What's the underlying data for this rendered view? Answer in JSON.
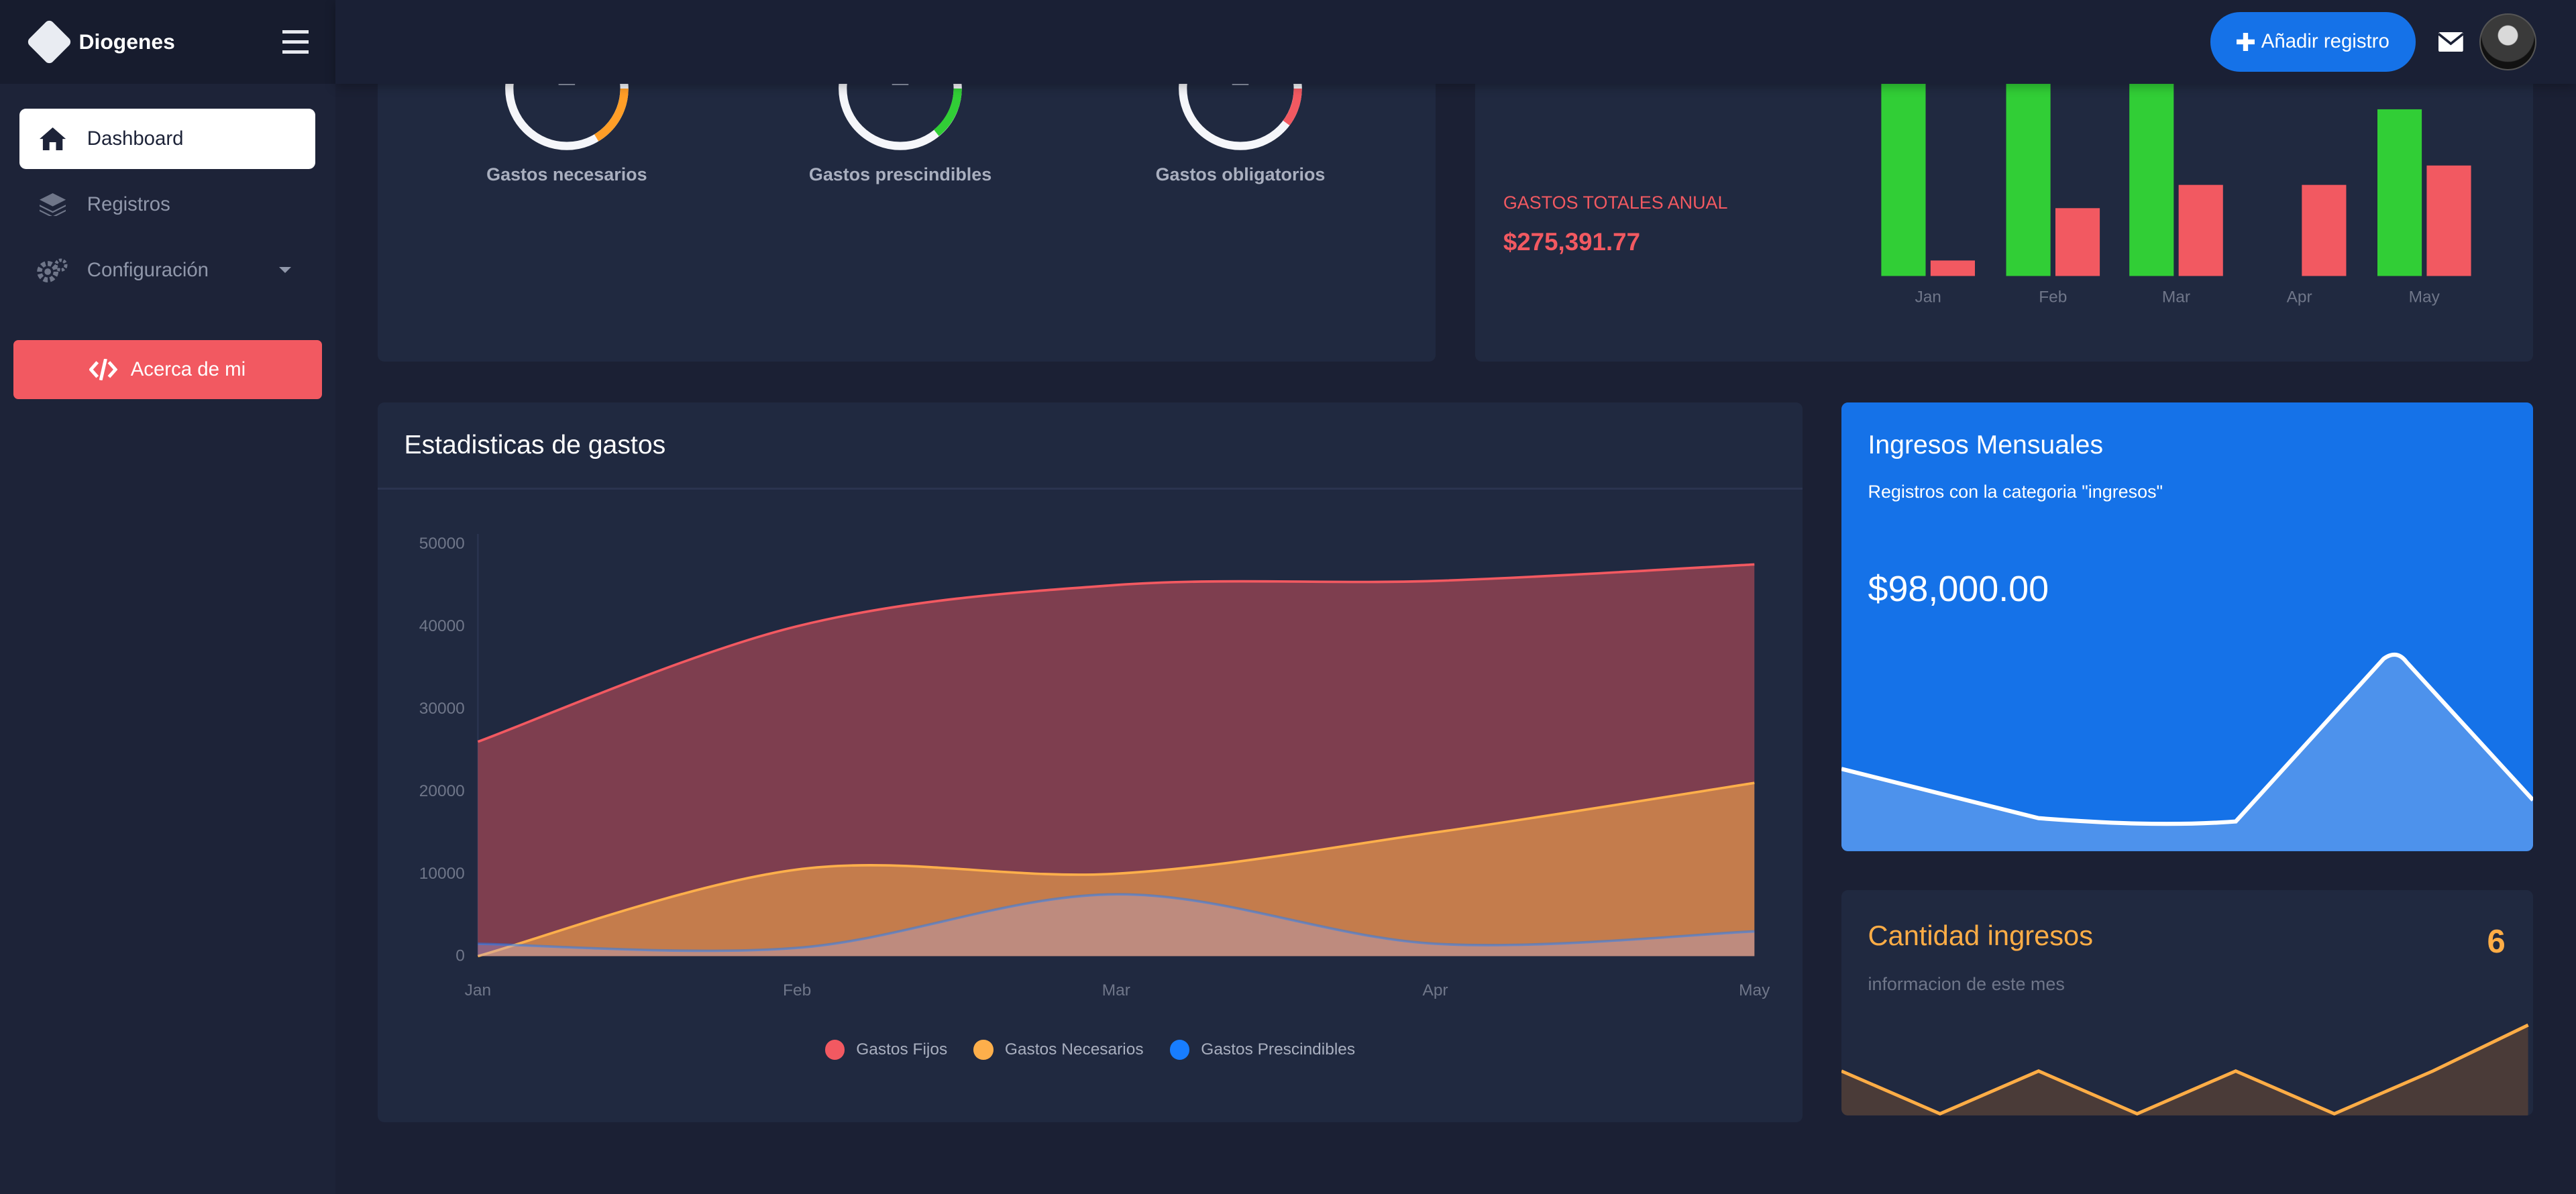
{
  "app": {
    "name": "Diogenes"
  },
  "sidebar": {
    "items": [
      {
        "label": "Dashboard",
        "icon": "home-icon",
        "active": true
      },
      {
        "label": "Registros",
        "icon": "layers-icon"
      },
      {
        "label": "Configuración",
        "icon": "gears-icon"
      }
    ],
    "about_label": "Acerca de mi"
  },
  "topbar": {
    "add_label": "Añadir registro",
    "mail_icon": "mail-icon",
    "avatar": "user-avatar"
  },
  "gauges": [
    {
      "label": "Gastos necesarios",
      "value": "2",
      "color": "#ff9e27"
    },
    {
      "label": "Gastos prescindibles",
      "value": "2",
      "color": "#31ce36"
    },
    {
      "label": "Gastos obligatorios",
      "value": "2",
      "color": "#f25961"
    }
  ],
  "annual": {
    "title": "GASTOS TOTALES ANUAL",
    "value": "$275,391.77"
  },
  "colors": {
    "green": "#31ce36",
    "red": "#f25961",
    "blue": "#1572e8",
    "orange": "#ffad46"
  },
  "chart_data": [
    {
      "type": "bar",
      "categories": [
        "Jan",
        "Feb",
        "Mar",
        "Apr",
        "May"
      ],
      "series": [
        {
          "values": [
            100,
            100,
            100,
            0,
            86
          ],
          "color": "#31ce36"
        },
        {
          "values": [
            8,
            35,
            47,
            47,
            57
          ],
          "color": "#f25961"
        }
      ],
      "ylim": [
        0,
        100
      ]
    },
    {
      "type": "area",
      "title": "Estadisticas de gastos",
      "categories": [
        "Jan",
        "Feb",
        "Mar",
        "Apr",
        "May"
      ],
      "ylim": [
        0,
        50000
      ],
      "yticks": [
        0,
        10000,
        20000,
        30000,
        40000,
        50000
      ],
      "series": [
        {
          "name": "Gastos Fijos",
          "values": [
            26000,
            40000,
            45000,
            45500,
            47500
          ],
          "color": "#f25961"
        },
        {
          "name": "Gastos Necesarios",
          "values": [
            0,
            10500,
            10000,
            15000,
            21000
          ],
          "color": "#fdaf4b"
        },
        {
          "name": "Gastos Prescindibles",
          "values": [
            1500,
            1000,
            7500,
            1500,
            3000
          ],
          "color": "#177dff"
        }
      ]
    },
    {
      "type": "area",
      "title": "Ingresos Mensuales",
      "subtitle": "Registros con la categoria \"ingresos\"",
      "series": [
        {
          "values": [
            10,
            4,
            3,
            3,
            25,
            7
          ]
        }
      ]
    },
    {
      "type": "line",
      "title": "Cantidad ingresos",
      "series": [
        {
          "values": [
            5,
            1,
            5,
            1,
            5,
            1,
            4,
            8
          ]
        }
      ]
    }
  ],
  "ingresos": {
    "title": "Ingresos Mensuales",
    "subtitle": "Registros con la categoria \"ingresos\"",
    "value": "$98,000.00"
  },
  "cantidad": {
    "title": "Cantidad ingresos",
    "count": "6",
    "subtitle": "informacion de este mes"
  }
}
